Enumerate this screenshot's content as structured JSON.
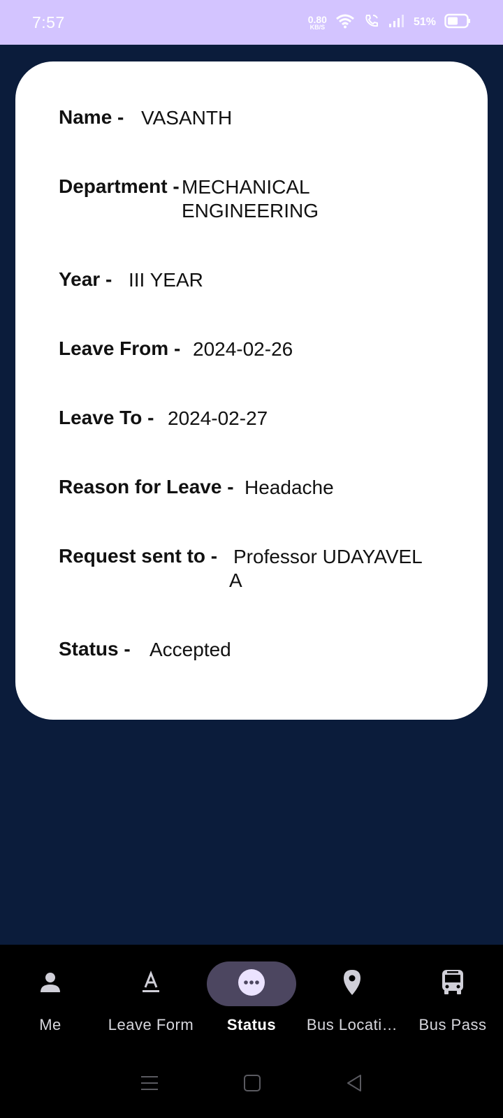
{
  "status_bar": {
    "time": "7:57",
    "net_speed_value": "0.80",
    "net_speed_unit": "KB/S",
    "battery": "51%",
    "icons": [
      "wifi-icon",
      "wifi-call-icon",
      "signal-icon",
      "battery-icon"
    ]
  },
  "details": [
    {
      "label": "Name -",
      "value": "VASANTH"
    },
    {
      "label": "Department -",
      "value": "MECHANICAL ENGINEERING"
    },
    {
      "label": "Year -",
      "value": "III YEAR"
    },
    {
      "label": "Leave From -",
      "value": "2024-02-26"
    },
    {
      "label": "Leave To -",
      "value": "2024-02-27"
    },
    {
      "label": "Reason for Leave -",
      "value": "Headache"
    },
    {
      "label": "Request sent to -",
      "value": "Professor UDAYAVEL A"
    },
    {
      "label": "Status -",
      "value": "Accepted"
    }
  ],
  "nav": [
    {
      "label": "Me",
      "icon": "person-icon"
    },
    {
      "label": "Leave Form",
      "icon": "text-format-icon"
    },
    {
      "label": "Status",
      "icon": "more-horizontal-icon",
      "active": true
    },
    {
      "label": "Bus Locati…",
      "icon": "location-pin-icon"
    },
    {
      "label": "Bus Pass",
      "icon": "bus-icon"
    }
  ],
  "colors": {
    "background": "#0b1c3b",
    "status_bar": "#d3c4ff",
    "card": "#ffffff",
    "nav_background": "#000000",
    "nav_active_pill": "#4c4660"
  }
}
